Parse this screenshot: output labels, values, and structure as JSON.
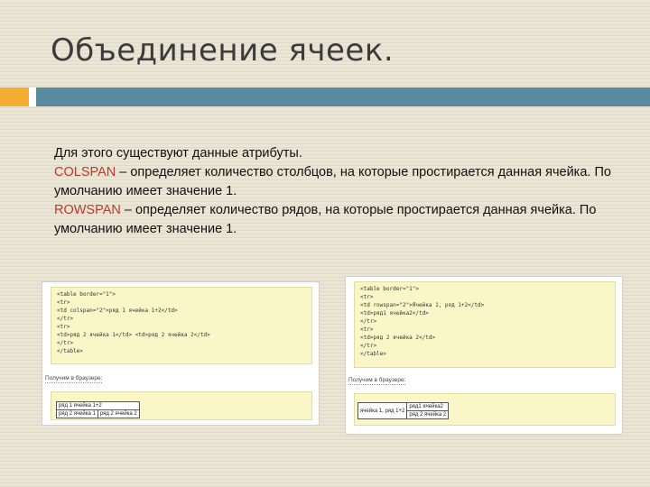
{
  "slide": {
    "title": "Объединение ячеек.",
    "intro": "Для этого существуют данные атрибуты.",
    "colspan_kw": "COLSPAN",
    "colspan_desc": " – определяет количество столбцов, на которые простирается данная ячейка. По умолчанию имеет значение 1.",
    "rowspan_kw": "ROWSPAN",
    "rowspan_desc": " – определяет количество рядов, на которые простирается данная ячейка. По умолчанию имеет значение 1.",
    "colors": {
      "accent": "#f4ac32",
      "bar": "#5a8a9e",
      "keyword": "#c0392b"
    }
  },
  "example_colspan": {
    "code": [
      "<table border=\"1\">",
      "<tr>",
      "<td colspan=\"2\">ряд 1 ячейка 1+2</td>",
      "</tr>",
      "<tr>",
      "<td>ряд 2 ячейка 1</td> <td>ряд 2 ячейка 2</td>",
      "</tr>",
      "</table>"
    ],
    "result_label": "Получим в браузере:",
    "cell_1": "ряд 1 ячейка 1+2",
    "cell_2": "ряд 2 ячейка 1",
    "cell_3": "ряд 2 ячейка 2"
  },
  "example_rowspan": {
    "code": [
      "<table border=\"1\">",
      "<tr>",
      "<td rowspan=\"2\">Ячейка 1, ряд 1+2</td>",
      "<td>ряд1 ячейка2</td>",
      "</tr>",
      "<tr>",
      "<td>ряд 2 ячейка 2</td>",
      "</tr>",
      "</table>"
    ],
    "result_label": "Получим в браузере:",
    "cell_1": "ячейка 1, ряд 1+2",
    "cell_2": "ряд1 ячейка2",
    "cell_3": "ряд 2 ячейка 2"
  }
}
